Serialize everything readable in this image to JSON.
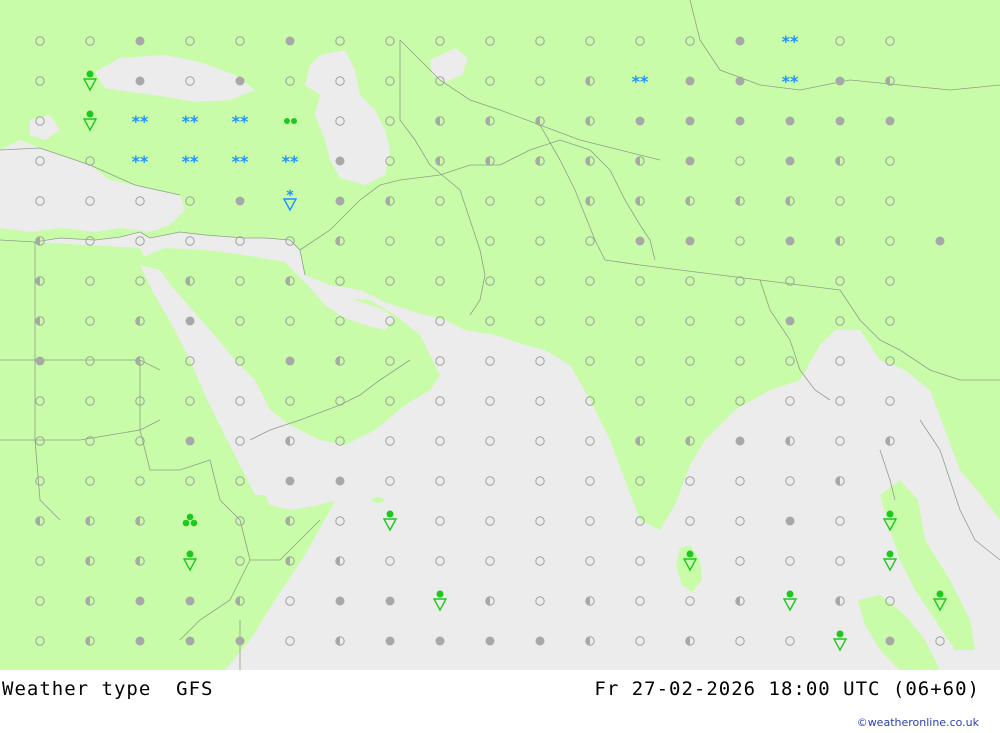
{
  "title": {
    "product": "Weather type",
    "model": "GFS",
    "valid_time": "Fr 27-02-2026 18:00 UTC (06+60)"
  },
  "credit": "©weatheronline.co.uk",
  "colors": {
    "land": "#c8fca8",
    "sea": "#ececec",
    "border": "#8fa08a",
    "rain": "#1ec81e",
    "snow": "#1e90ff",
    "cloud_gray": "#a8a8a8",
    "outline_gray": "#a0a0a0"
  },
  "symbol_legend": {
    "clear": "open-circle",
    "partly-cloudy": "half-filled-circle",
    "overcast": "filled-circle",
    "rain-showers": "green-dot-with-triangle",
    "snow": "blue-asterisks",
    "thunder": "green-trefoil"
  },
  "symbols": [
    {
      "type": "snow",
      "row": 0,
      "col": 15
    },
    {
      "type": "shower",
      "row": 1,
      "col": 1
    },
    {
      "type": "snow",
      "row": 1,
      "col": 12
    },
    {
      "type": "snow",
      "row": 1,
      "col": 15
    },
    {
      "type": "shower",
      "row": 2,
      "col": 1
    },
    {
      "type": "snow",
      "row": 2,
      "col": 2
    },
    {
      "type": "snow",
      "row": 2,
      "col": 3
    },
    {
      "type": "snow",
      "row": 2,
      "col": 4
    },
    {
      "type": "drizzle",
      "row": 2,
      "col": 5
    },
    {
      "type": "snow",
      "row": 3,
      "col": 2
    },
    {
      "type": "snow",
      "row": 3,
      "col": 3
    },
    {
      "type": "snow",
      "row": 3,
      "col": 4
    },
    {
      "type": "snow",
      "row": 3,
      "col": 5
    },
    {
      "type": "snow-shower",
      "row": 4,
      "col": 5
    },
    {
      "type": "thunder",
      "row": 12,
      "col": 3
    },
    {
      "type": "shower",
      "row": 12,
      "col": 7
    },
    {
      "type": "shower",
      "row": 12,
      "col": 17
    },
    {
      "type": "shower",
      "row": 13,
      "col": 3
    },
    {
      "type": "shower",
      "row": 13,
      "col": 13
    },
    {
      "type": "shower",
      "row": 13,
      "col": 17
    },
    {
      "type": "shower",
      "row": 14,
      "col": 8
    },
    {
      "type": "shower",
      "row": 14,
      "col": 15
    },
    {
      "type": "shower",
      "row": 14,
      "col": 18
    },
    {
      "type": "shower",
      "row": 15,
      "col": 16
    }
  ],
  "cloud_grid": [
    "oofoofoooooooofooo",
    "oofofooooooeoffffe",
    "ooooofooeeeeffffff",
    "oooooffoeeeeefofeo",
    "oooofofeoooeeeeeoo",
    "eoooooeoooooffofeof",
    "eooeoeoooooooooooo",
    "eoefooooooooooofoo",
    "foeoofeooooooooooo",
    "oooooooooooooooooo",
    "ooofoeooooooeefeoe",
    "oooooffoooooooooe",
    "eeeeoeooooooooofoo",
    "oeeeoeeooooooooooo",
    "oeffeoffeeoeooeoeo",
    "oefffoeffffeoeooffo"
  ]
}
